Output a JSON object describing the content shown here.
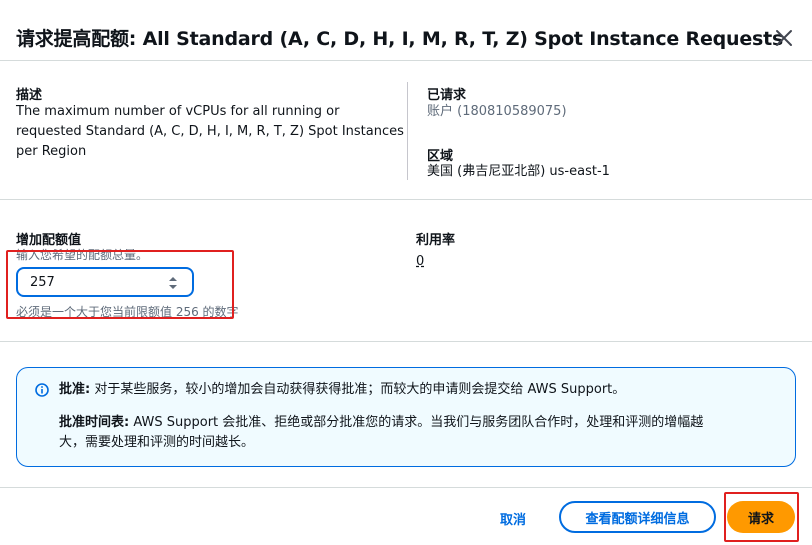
{
  "modal": {
    "title": "请求提高配额: All Standard (A, C, D, H, I, M, R, T, Z) Spot Instance Requests",
    "close_icon": "close-icon"
  },
  "details": {
    "description_label": "描述",
    "description_line1": "The maximum number of vCPUs for all running or",
    "description_line2": "requested Standard (A, C, D, H, I, M, R, T, Z) Spot Instances",
    "description_line3": "per Region",
    "requested_label": "已请求",
    "requested_value": "账户 (180810589075)",
    "region_label": "区域",
    "region_value": "美国 (弗吉尼亚北部) us-east-1"
  },
  "quota": {
    "increase_label": "增加配额值",
    "increase_hint": "输入您希望的配额总量。",
    "input_value": "257",
    "validation_text": "必须是一个大于您当前限额值 256 的数字",
    "utilization_label": "利用率",
    "utilization_value": "0"
  },
  "alert": {
    "icon": "info-icon",
    "line1_bold": "批准:",
    "line1_text": " 对于某些服务，较小的增加会自动获得获得批准；而较大的申请则会提交给 AWS Support。",
    "line2_bold": "批准时间表:",
    "line2_text": " AWS Support 会批准、拒绝或部分批准您的请求。当我们与服务团队合作时，处理和评测的增幅越",
    "line3_text": "大，需要处理和评测的时间越长。",
    "colors": {
      "background": "#f0fbff",
      "border": "#006ce0"
    }
  },
  "footer": {
    "cancel_label": "取消",
    "view_details_label": "查看配额详细信息",
    "submit_label": "请求"
  },
  "colors": {
    "accent": "#006ce0",
    "primary_button": "#ff9900",
    "highlight": "#e0201f"
  }
}
